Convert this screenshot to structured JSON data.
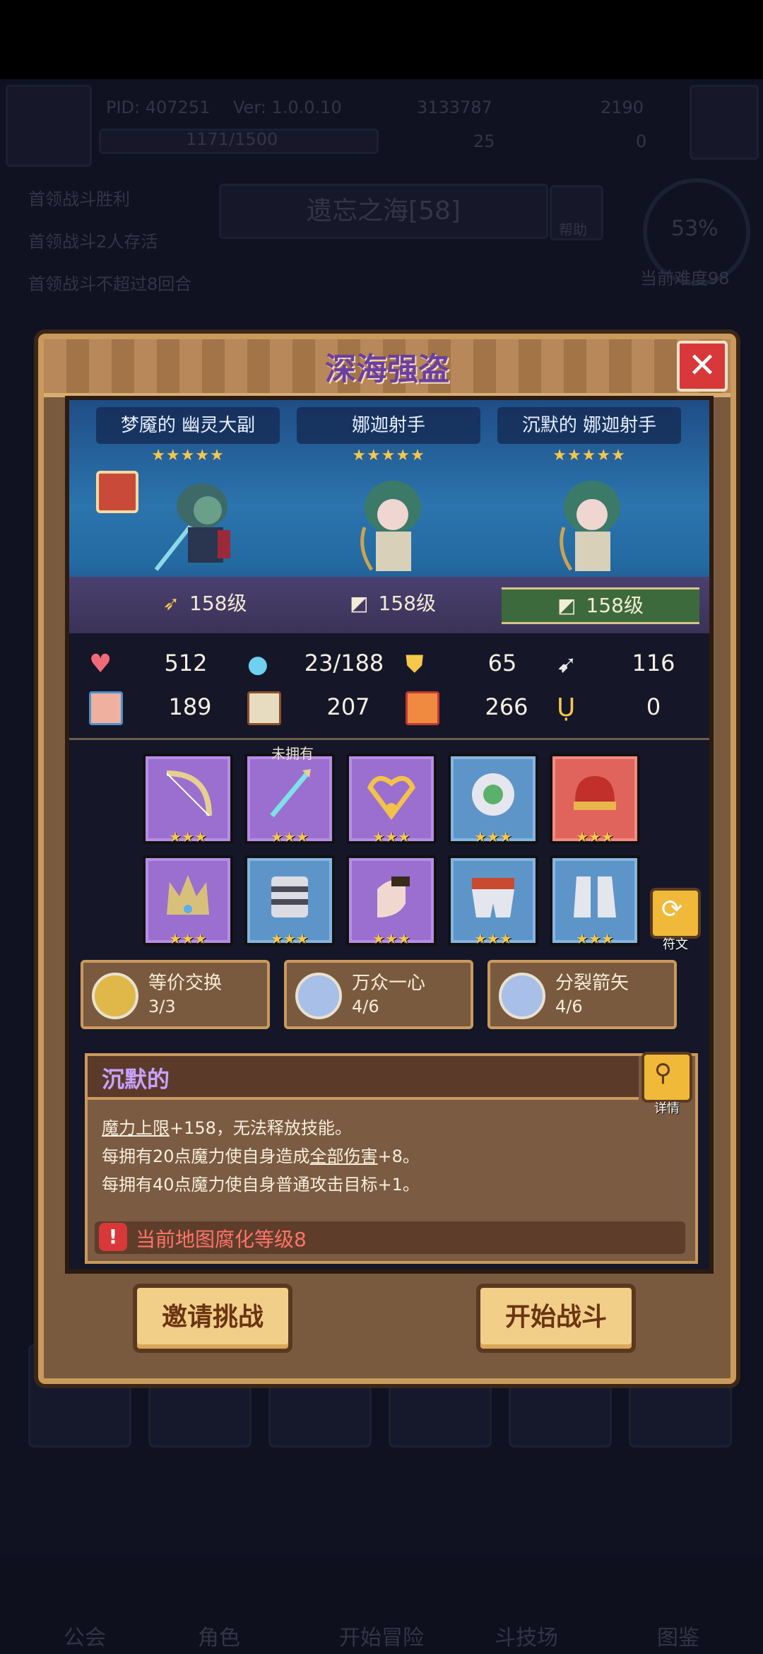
{
  "hud": {
    "pid": "PID: 407251",
    "version": "Ver: 1.0.0.10",
    "gold": "3133787",
    "gems": "2190",
    "exp": "1171/1500",
    "clover": "25",
    "other": "0"
  },
  "stage": {
    "name": "遗忘之海[58]",
    "help": "帮助",
    "difficulty_percent": "53%",
    "difficulty_label": "当前难度98",
    "objectives": [
      "首领战斗胜利",
      "首领战斗2人存活",
      "首领战斗不超过8回合"
    ]
  },
  "bottom_nav": [
    "公会",
    "角色",
    "开始冒险",
    "斗技场",
    "图鉴"
  ],
  "modal": {
    "title": "深海强盗",
    "heroes": [
      {
        "name": "梦魇的 幽灵大副",
        "stars": "★★★★★",
        "level": "158级"
      },
      {
        "name": "娜迦射手",
        "stars": "★★★★★",
        "level": "158级"
      },
      {
        "name": "沉默的 娜迦射手",
        "stars": "★★★★★",
        "level": "158级"
      }
    ],
    "stats": {
      "hp": "512",
      "mana": "23/188",
      "defense": "65",
      "speed": "116",
      "attack": "189",
      "magic": "207",
      "crit": "266",
      "luck": "0"
    },
    "equipment_badge": "未拥有",
    "equip_stars": "★★★",
    "rune_button": "符文",
    "runes": [
      {
        "name": "等价交换",
        "count": "3/3"
      },
      {
        "name": "万众一心",
        "count": "4/6"
      },
      {
        "name": "分裂箭矢",
        "count": "4/6"
      }
    ],
    "desc": {
      "title": "沉默的",
      "detail_button": "详情",
      "line1_term": "魔力上限",
      "line1_rest": "+158，无法释放技能。",
      "line2_pre": "每拥有20点魔力使自身造成",
      "line2_term": "全部伤害",
      "line2_post": "+8。",
      "line3": "每拥有40点魔力使自身普通攻击目标+1。",
      "warning": "当前地图腐化等级8"
    },
    "invite_button": "邀请挑战",
    "start_button": "开始战斗"
  },
  "colors": {
    "frame": "#c99a5c",
    "panel": "#7a5a3e",
    "title": "#6b3fa2",
    "warning": "#ff7468"
  }
}
